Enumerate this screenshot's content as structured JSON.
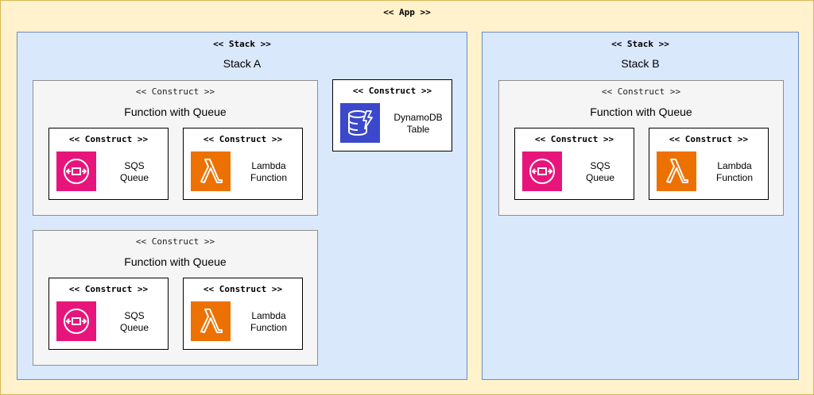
{
  "app": {
    "label": "<< App >>"
  },
  "stacks": [
    {
      "stereotype": "<< Stack >>",
      "name": "Stack A",
      "groups": [
        {
          "stereotype": "<< Construct >>",
          "name": "Function with Queue",
          "constructs": [
            {
              "stereotype": "<< Construct >>",
              "icon": "sqs-icon",
              "line1": "SQS",
              "line2": "Queue"
            },
            {
              "stereotype": "<< Construct >>",
              "icon": "lambda-icon",
              "line1": "Lambda",
              "line2": "Function"
            }
          ]
        },
        {
          "stereotype": "<< Construct >>",
          "name": "Function with Queue",
          "constructs": [
            {
              "stereotype": "<< Construct >>",
              "icon": "sqs-icon",
              "line1": "SQS",
              "line2": "Queue"
            },
            {
              "stereotype": "<< Construct >>",
              "icon": "lambda-icon",
              "line1": "Lambda",
              "line2": "Function"
            }
          ]
        }
      ],
      "standalone": {
        "stereotype": "<< Construct >>",
        "icon": "dynamodb-icon",
        "line1": "DynamoDB",
        "line2": "Table"
      }
    },
    {
      "stereotype": "<< Stack >>",
      "name": "Stack B",
      "groups": [
        {
          "stereotype": "<< Construct >>",
          "name": "Function with Queue",
          "constructs": [
            {
              "stereotype": "<< Construct >>",
              "icon": "sqs-icon",
              "line1": "SQS",
              "line2": "Queue"
            },
            {
              "stereotype": "<< Construct >>",
              "icon": "lambda-icon",
              "line1": "Lambda",
              "line2": "Function"
            }
          ]
        }
      ]
    }
  ],
  "colors": {
    "app_fill": "#fff2cc",
    "stack_fill": "#dae8fc",
    "group_fill": "#f5f5f5",
    "sqs": "#e7157b",
    "lambda": "#ed7100",
    "dynamodb": "#3b48cc"
  }
}
